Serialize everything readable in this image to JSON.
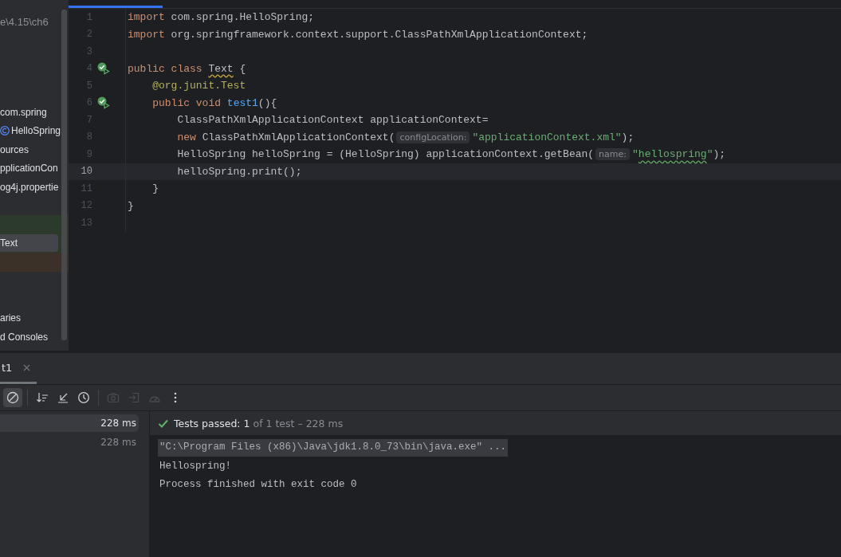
{
  "project_panel": {
    "path": "e\\4.15\\ch6",
    "items": [
      {
        "kind": "blank"
      },
      {
        "kind": "blank"
      },
      {
        "kind": "blank"
      },
      {
        "kind": "blank"
      },
      {
        "kind": "package",
        "label": "com.spring",
        "selected": false
      },
      {
        "kind": "class",
        "label": "HelloSpring",
        "selected": false
      },
      {
        "kind": "folder",
        "label": "ources",
        "selected": false
      },
      {
        "kind": "file",
        "label": "pplicationCon",
        "selected": false
      },
      {
        "kind": "file",
        "label": "og4j.propertie",
        "selected": false
      },
      {
        "kind": "blank"
      },
      {
        "kind": "blank",
        "color": "#2c3a2c"
      },
      {
        "kind": "file",
        "label": "Text",
        "selected": true,
        "color": "#2c3a2c"
      },
      {
        "kind": "blank",
        "color": "#3b3128"
      },
      {
        "kind": "blank"
      },
      {
        "kind": "blank"
      },
      {
        "kind": "folder",
        "label": "aries",
        "selected": false
      },
      {
        "kind": "folder",
        "label": "d Consoles",
        "selected": false
      }
    ]
  },
  "editor": {
    "lines": [
      {
        "number": "1",
        "current": false,
        "run": false,
        "tokens": [
          {
            "kind": "keyword",
            "text": "import"
          },
          {
            "kind": "plain",
            "text": " com.spring.HelloSpring;"
          }
        ]
      },
      {
        "number": "2",
        "current": false,
        "run": false,
        "tokens": [
          {
            "kind": "keyword",
            "text": "import"
          },
          {
            "kind": "plain",
            "text": " org.springframework.context.support.ClassPathXmlApplicationContext;"
          }
        ]
      },
      {
        "number": "3",
        "current": false,
        "run": false
      },
      {
        "number": "4",
        "current": false,
        "run": true,
        "tokens": [
          {
            "kind": "keyword",
            "text": "public class "
          },
          {
            "kind": "plain",
            "text": "Text",
            "squiggle": true
          },
          {
            "kind": "plain",
            "text": " {"
          }
        ]
      },
      {
        "number": "5",
        "current": false,
        "run": false,
        "tokens": [
          {
            "kind": "annotation",
            "text": "    @org.junit.Test"
          }
        ]
      },
      {
        "number": "6",
        "current": false,
        "run": true,
        "tokens": [
          {
            "kind": "keyword",
            "text": "    public void "
          },
          {
            "kind": "method",
            "text": "test1"
          },
          {
            "kind": "plain",
            "text": "(){"
          }
        ]
      },
      {
        "number": "7",
        "current": false,
        "run": false,
        "tokens": [
          {
            "kind": "plain",
            "text": "        ClassPathXmlApplicationContext applicationContext="
          }
        ]
      },
      {
        "number": "8",
        "current": false,
        "run": false,
        "tokens": [
          {
            "kind": "keyword",
            "text": "        new"
          },
          {
            "kind": "plain",
            "text": " ClassPathXmlApplicationContext("
          },
          {
            "kind": "hint",
            "text": "configLocation:"
          },
          {
            "kind": "string",
            "text": "\"applicationContext.xml\""
          },
          {
            "kind": "plain",
            "text": ");"
          }
        ]
      },
      {
        "number": "9",
        "current": false,
        "run": false,
        "tokens": [
          {
            "kind": "plain",
            "text": "        HelloSpring helloSpring = (HelloSpring) applicationContext.getBean("
          },
          {
            "kind": "hint",
            "text": "name:"
          },
          {
            "kind": "string",
            "text": "\""
          },
          {
            "kind": "string",
            "text": "hellospring",
            "squiggle": true
          },
          {
            "kind": "string",
            "text": "\""
          },
          {
            "kind": "plain",
            "text": ");"
          }
        ]
      },
      {
        "number": "10",
        "current": true,
        "run": false,
        "tokens": [
          {
            "kind": "plain",
            "text": "        helloSpring.print();"
          }
        ]
      },
      {
        "number": "11",
        "current": false,
        "run": false,
        "tokens": [
          {
            "kind": "plain",
            "text": "    }"
          }
        ]
      },
      {
        "number": "12",
        "current": false,
        "run": false,
        "tokens": [
          {
            "kind": "plain",
            "text": "}"
          }
        ]
      },
      {
        "number": "13",
        "current": false,
        "run": false
      }
    ]
  },
  "run_panel": {
    "tab": {
      "label": "t1",
      "selected": true
    },
    "toolbar": [
      {
        "kind": "stop",
        "on": true,
        "disabled": false
      },
      {
        "kind": "separator"
      },
      {
        "kind": "sort",
        "on": false,
        "disabled": false
      },
      {
        "kind": "collapse",
        "on": false,
        "disabled": false
      },
      {
        "kind": "history",
        "on": false,
        "disabled": false
      },
      {
        "kind": "separator"
      },
      {
        "kind": "camera",
        "disabled": true
      },
      {
        "kind": "import",
        "disabled": true
      },
      {
        "kind": "gauge",
        "disabled": true
      },
      {
        "kind": "more",
        "on": false,
        "disabled": false
      }
    ],
    "tests": [
      {
        "time": "228 ms",
        "selected": true
      },
      {
        "time": "228 ms",
        "selected": false
      }
    ],
    "status": {
      "passed": true,
      "title": "Tests passed: 1",
      "detail": "of 1 test – 228 ms"
    },
    "console": [
      {
        "kind": "command",
        "text": "\"C:\\Program Files (x86)\\Java\\jdk1.8.0_73\\bin\\java.exe\" ..."
      },
      {
        "kind": "output",
        "text": "Hellospring!"
      },
      {
        "kind": "output",
        "text": "Process finished with exit code 0"
      }
    ]
  }
}
